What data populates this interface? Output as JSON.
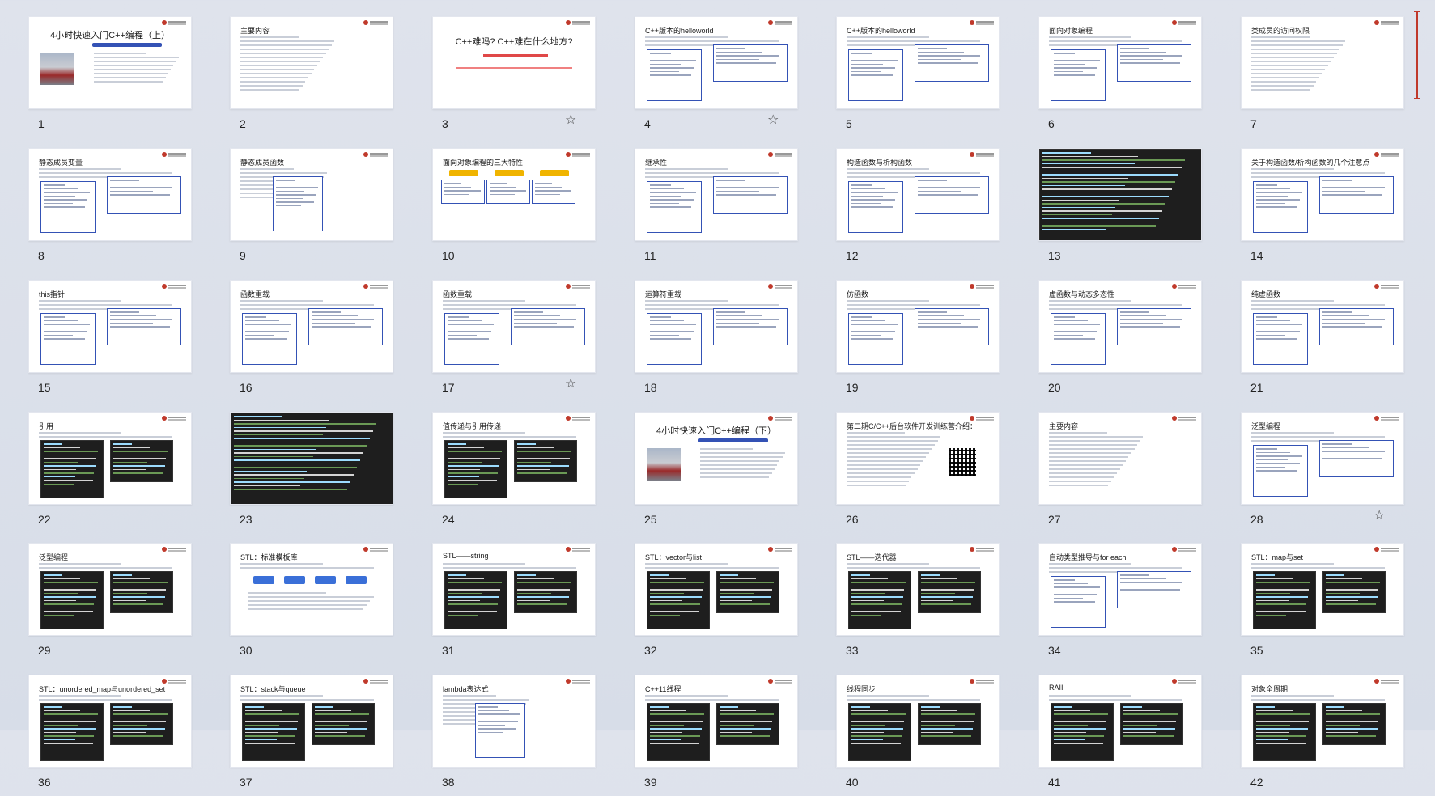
{
  "slides": [
    {
      "n": "1",
      "title": "4小时快速入门C++编程（上）",
      "style": "cover",
      "star": false
    },
    {
      "n": "2",
      "title": "主要内容",
      "style": "list",
      "star": false
    },
    {
      "n": "3",
      "title": "C++难吗? C++难在什么地方?",
      "style": "center",
      "star": true
    },
    {
      "n": "4",
      "title": "C++版本的helloworld",
      "style": "boxes",
      "star": true
    },
    {
      "n": "5",
      "title": "C++版本的helloworld",
      "style": "boxes",
      "star": false
    },
    {
      "n": "6",
      "title": "面向对象编程",
      "style": "boxes",
      "star": false
    },
    {
      "n": "7",
      "title": "类成员的访问权限",
      "style": "list",
      "star": false
    },
    {
      "n": "8",
      "title": "静态成员变量",
      "style": "boxes",
      "star": false
    },
    {
      "n": "9",
      "title": "静态成员函数",
      "style": "list-boxes",
      "star": false
    },
    {
      "n": "10",
      "title": "面向对象编程的三大特性",
      "style": "three",
      "star": false
    },
    {
      "n": "11",
      "title": "继承性",
      "style": "boxes",
      "star": false
    },
    {
      "n": "12",
      "title": "构造函数与析构函数",
      "style": "boxes",
      "star": false
    },
    {
      "n": "13",
      "title": "",
      "style": "dark",
      "star": false
    },
    {
      "n": "14",
      "title": "关于构造函数/析构函数的几个注意点",
      "style": "boxes",
      "star": false
    },
    {
      "n": "15",
      "title": "this指针",
      "style": "boxes",
      "star": false
    },
    {
      "n": "16",
      "title": "函数重载",
      "style": "boxes",
      "star": false
    },
    {
      "n": "17",
      "title": "函数重载",
      "style": "boxes",
      "star": true
    },
    {
      "n": "18",
      "title": "运算符重载",
      "style": "boxes",
      "star": false
    },
    {
      "n": "19",
      "title": "仿函数",
      "style": "boxes",
      "star": false
    },
    {
      "n": "20",
      "title": "虚函数与动态多态性",
      "style": "boxes",
      "star": false
    },
    {
      "n": "21",
      "title": "纯虚函数",
      "style": "boxes",
      "star": false
    },
    {
      "n": "22",
      "title": "引用",
      "style": "code",
      "star": false
    },
    {
      "n": "23",
      "title": "",
      "style": "dark",
      "star": false
    },
    {
      "n": "24",
      "title": "值传递与引用传递",
      "style": "code",
      "star": false
    },
    {
      "n": "25",
      "title": "4小时快速入门C++编程（下）",
      "style": "cover",
      "star": false
    },
    {
      "n": "26",
      "title": "第二期C/C++后台软件开发训练营介绍：",
      "style": "qr",
      "star": false
    },
    {
      "n": "27",
      "title": "主要内容",
      "style": "list",
      "star": false
    },
    {
      "n": "28",
      "title": "泛型编程",
      "style": "boxes",
      "star": true
    },
    {
      "n": "29",
      "title": "泛型编程",
      "style": "code",
      "star": false
    },
    {
      "n": "30",
      "title": "STL：标准模板库",
      "style": "chips",
      "star": false
    },
    {
      "n": "31",
      "title": "STL——string",
      "style": "code",
      "star": false
    },
    {
      "n": "32",
      "title": "STL：vector与list",
      "style": "code",
      "star": false
    },
    {
      "n": "33",
      "title": "STL——迭代器",
      "style": "code",
      "star": false
    },
    {
      "n": "34",
      "title": "自动类型推导与for each",
      "style": "boxes",
      "star": false
    },
    {
      "n": "35",
      "title": "STL：map与set",
      "style": "code",
      "star": false
    },
    {
      "n": "36",
      "title": "STL：unordered_map与unordered_set",
      "style": "code",
      "star": false
    },
    {
      "n": "37",
      "title": "STL：stack与queue",
      "style": "code",
      "star": false
    },
    {
      "n": "38",
      "title": "lambda表达式",
      "style": "list-boxes",
      "star": false
    },
    {
      "n": "39",
      "title": "C++11线程",
      "style": "code",
      "star": false
    },
    {
      "n": "40",
      "title": "线程同步",
      "style": "code",
      "star": false
    },
    {
      "n": "41",
      "title": "RAII",
      "style": "code",
      "star": false
    },
    {
      "n": "42",
      "title": "对象全周期",
      "style": "code",
      "star": false
    }
  ],
  "icons": {
    "star": "star-outline-icon"
  },
  "colors": {
    "accent": "#3452b5",
    "red": "#d22222",
    "bg": "#dde2eb"
  }
}
